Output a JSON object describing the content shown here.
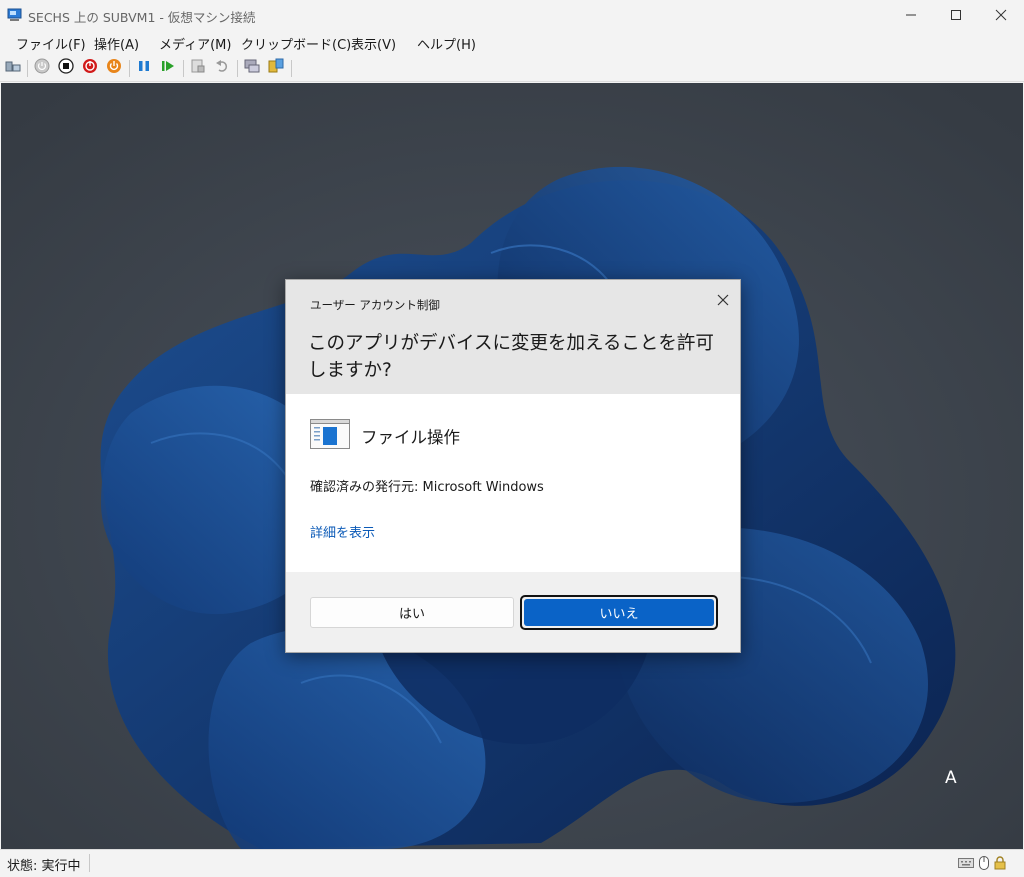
{
  "window": {
    "title": "SECHS 上の SUBVM1 - 仮想マシン接続",
    "icons": [
      "vm-connection-icon",
      "minimize-icon",
      "maximize-icon",
      "close-icon"
    ]
  },
  "menu": [
    "ファイル(F)",
    "操作(A)",
    "メディア(M)",
    "クリップボード(C)",
    "表示(V)",
    "ヘルプ(H)"
  ],
  "toolbar": {
    "icons": [
      "ctrl-alt-del-icon",
      "start-icon",
      "turn-off-icon",
      "shutdown-icon",
      "power-save-icon",
      "pause-icon",
      "resume-icon",
      "checkpoint-icon",
      "revert-icon",
      "enhanced-session-icon",
      "share-icon"
    ]
  },
  "dialog": {
    "caption": "ユーザー アカウント制御",
    "question": "このアプリがデバイスに変更を加えることを許可しますか?",
    "app_name": "ファイル操作",
    "publisher": "確認済みの発行元: Microsoft Windows",
    "details_link": "詳細を表示",
    "yes_label": "はい",
    "no_label": "いいえ",
    "accent_color": "#0a63c7"
  },
  "desktop": {
    "cursor_glyph": "A"
  },
  "status": {
    "text": "状態: 実行中",
    "icons": [
      "keyboard-icon",
      "mouse-icon",
      "lock-icon"
    ]
  }
}
